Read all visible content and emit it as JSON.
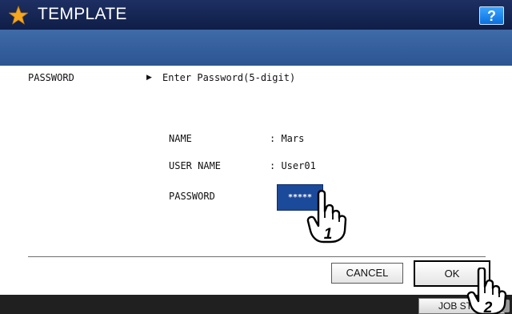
{
  "header": {
    "title": "TEMPLATE",
    "help_label": "?",
    "star_icon": "star-icon"
  },
  "content": {
    "field_label": "PASSWORD",
    "instruction": "Enter Password(5-digit)",
    "name_label": "NAME",
    "name_value": ": Mars",
    "user_name_label": "USER NAME",
    "user_name_value": ": User01",
    "password_label": "PASSWORD",
    "password_value": "*****"
  },
  "buttons": {
    "cancel": "CANCEL",
    "ok": "OK"
  },
  "footer": {
    "job_status": "JOB STATUS"
  },
  "callouts": {
    "step1": "1",
    "step2": "2"
  },
  "colors": {
    "title_bar": "#0f1e47",
    "band": "#3f6ba8",
    "field": "#1c4a9a",
    "help": "#0a6fe0",
    "star": "#f5a623"
  }
}
